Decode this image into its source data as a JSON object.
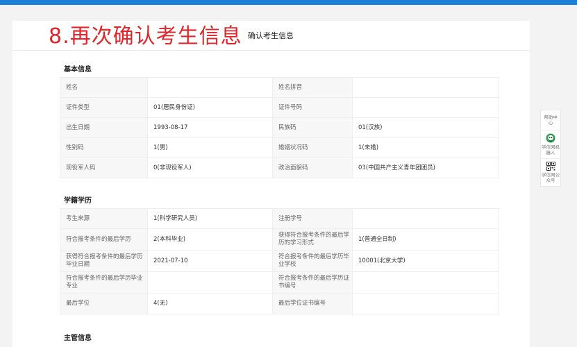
{
  "overlay_caption": "8.再次确认考生信息",
  "page_title": "确认考生信息",
  "sections": {
    "basic": {
      "title": "基本信息",
      "rows": [
        [
          "姓名",
          "",
          "姓名拼音",
          ""
        ],
        [
          "证件类型",
          "01(居民身份证)",
          "证件号码",
          ""
        ],
        [
          "出生日期",
          "1993-08-17",
          "民族码",
          "01(汉族)"
        ],
        [
          "性别码",
          "1(男)",
          "婚姻状况码",
          "1(未婚)"
        ],
        [
          "现役军人码",
          "0(非现役军人)",
          "政治面貌码",
          "03(中国共产主义青年团团员)"
        ]
      ]
    },
    "education": {
      "title": "学籍学历",
      "rows": [
        [
          "考生来源",
          "1(科学研究人员)",
          "注册学号",
          ""
        ],
        [
          "符合报考条件的最后学历",
          "2(本科毕业)",
          "获得符合报考条件的最后学历的学习形式",
          "1(普通全日制)"
        ],
        [
          "获得符合报考条件的最后学历毕业日期",
          "2021-07-10",
          "符合报考条件的最后学历毕业学校",
          "10001(北京大学)"
        ],
        [
          "符合报考条件的最后学历毕业专业",
          "",
          "符合报考条件的最后学历证书编号",
          ""
        ],
        [
          "最后学位",
          "4(无)",
          "最后学位证书编号",
          ""
        ]
      ]
    },
    "next_section_partial": "主管信息"
  },
  "sidebar": {
    "help": "帮助中心",
    "robot": "学信网机器人",
    "official": "学信网公众号",
    "robot_icon": "robot-avatar-icon",
    "official_icon": "qr-code-icon"
  }
}
